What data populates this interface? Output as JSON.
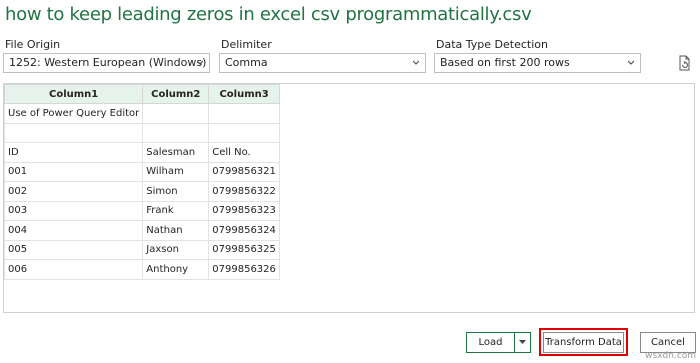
{
  "title": "how to keep leading zeros in excel csv programmatically.csv",
  "file_origin": {
    "label": "File Origin",
    "value": "1252: Western European (Windows)"
  },
  "delimiter": {
    "label": "Delimiter",
    "value": "Comma"
  },
  "detection": {
    "label": "Data Type Detection",
    "value": "Based on first 200 rows"
  },
  "icons": {
    "refresh": "refresh-file-icon",
    "chevron": "chevron-down-icon"
  },
  "table": {
    "headers": [
      "Column1",
      "Column2",
      "Column3"
    ],
    "rows": [
      [
        "Use of Power Query Editor",
        "",
        ""
      ],
      [
        "",
        "",
        ""
      ],
      [
        "ID",
        "Salesman",
        "Cell No."
      ],
      [
        "001",
        "Wilham",
        "0799856321"
      ],
      [
        "002",
        "Simon",
        "0799856322"
      ],
      [
        "003",
        "Frank",
        "0799856323"
      ],
      [
        "004",
        "Nathan",
        "0799856324"
      ],
      [
        "005",
        "Jaxson",
        "0799856325"
      ],
      [
        "006",
        "Anthony",
        "0799856326"
      ]
    ]
  },
  "buttons": {
    "load": "Load",
    "transform": "Transform Data",
    "cancel": "Cancel"
  },
  "colors": {
    "title": "#217346",
    "header_bg": "#e6f2ec",
    "highlight": "#e00000"
  },
  "watermark": "wsxdn.com"
}
